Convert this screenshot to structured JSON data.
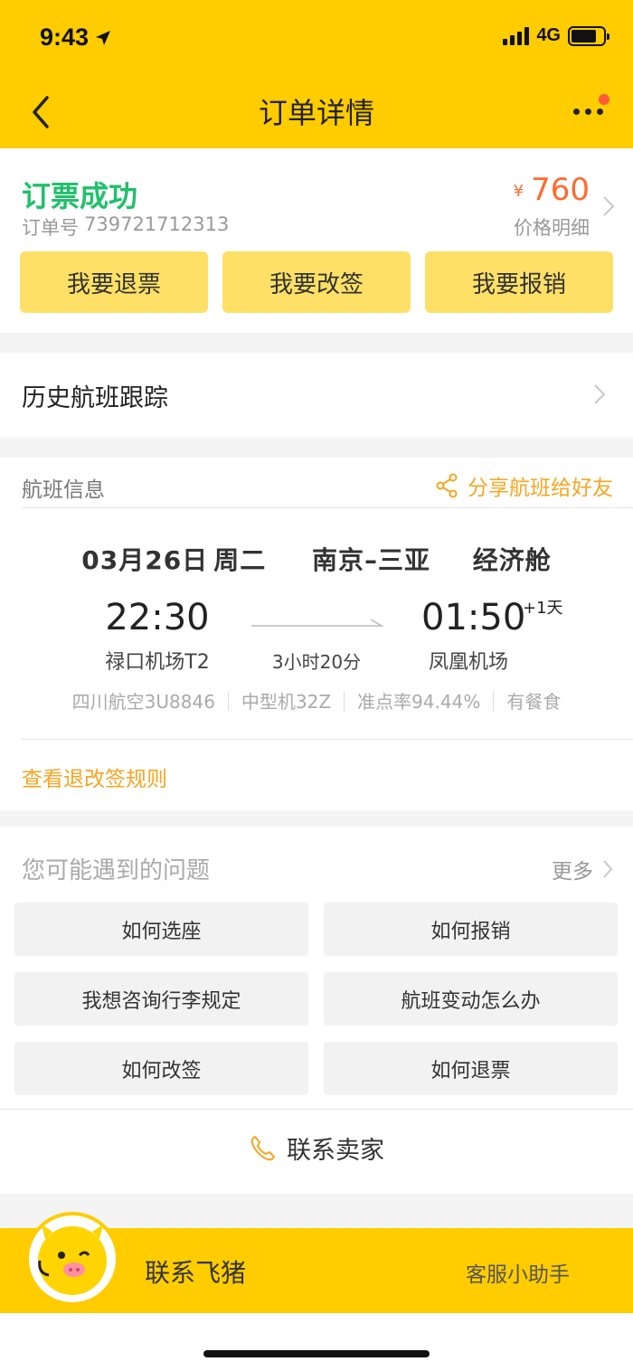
{
  "status_bar": {
    "time": "9:43",
    "network": "4G"
  },
  "nav": {
    "title": "订单详情"
  },
  "order": {
    "status": "订票成功",
    "order_no_label": "订单号",
    "order_no": "739721712313",
    "currency": "¥",
    "price": "760",
    "price_detail": "价格明细",
    "actions": [
      {
        "label": "我要退票"
      },
      {
        "label": "我要改签"
      },
      {
        "label": "我要报销"
      }
    ]
  },
  "history": {
    "label": "历史航班跟踪"
  },
  "flight": {
    "section_title": "航班信息",
    "share_label": "分享航班给好友",
    "date": "03月26日",
    "weekday": "周二",
    "route": "南京–三亚",
    "cabin": "经济舱",
    "dep_time": "22:30",
    "dep_airport": "禄口机场T2",
    "arr_time": "01:50",
    "arr_plus": "+1天",
    "arr_airport": "凤凰机场",
    "duration": "3小时20分",
    "meta": [
      "四川航空3U8846",
      "中型机32Z",
      "准点率94.44%",
      "有餐食"
    ],
    "rules_link": "查看退改签规则"
  },
  "faq": {
    "title": "您可能遇到的问题",
    "more": "更多",
    "items": [
      {
        "label": "如何选座"
      },
      {
        "label": "如何报销"
      },
      {
        "label": "我想咨询行李规定"
      },
      {
        "label": "航班变动怎么办"
      },
      {
        "label": "如何改签"
      },
      {
        "label": "如何退票"
      }
    ],
    "contact_seller": "联系卖家"
  },
  "footer": {
    "label": "联系飞猪",
    "assistant": "客服小助手"
  },
  "colors": {
    "brand_yellow": "#ffcc00",
    "button_yellow": "#ffe066",
    "success_green": "#21c06a",
    "price_orange": "#ff6a2e",
    "link_orange": "#f5a623"
  },
  "icons": [
    "location-arrow-icon",
    "signal-icon",
    "battery-icon",
    "back-arrow-icon",
    "more-dots-icon",
    "chevron-right-icon",
    "share-icon",
    "phone-icon",
    "mascot-icon"
  ]
}
